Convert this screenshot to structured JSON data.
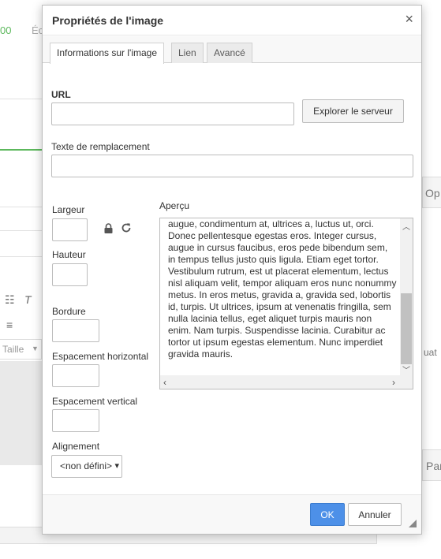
{
  "background": {
    "left_frag1": "00",
    "left_frag2": "Éc",
    "right_frag1": "Op",
    "right_frag2": "uat",
    "right_frag3": "Par",
    "size_dropdown": "Taille"
  },
  "dialog": {
    "title": "Propriétés de l'image",
    "close_glyph": "×",
    "tabs": [
      {
        "label": "Informations sur l'image"
      },
      {
        "label": "Lien"
      },
      {
        "label": "Avancé"
      }
    ],
    "url_label": "URL",
    "url_value": "",
    "browse_button": "Explorer le serveur",
    "alt_label": "Texte de remplacement",
    "alt_value": "",
    "width_label": "Largeur",
    "height_label": "Hauteur",
    "border_label": "Bordure",
    "hspace_label": "Espacement horizontal",
    "vspace_label": "Espacement vertical",
    "align_label": "Alignement",
    "align_value": "<non défini>",
    "preview_label": "Aperçu",
    "preview_text": "augue, condimentum at, ultrices a, luctus ut, orci. Donec pellentesque egestas eros. Integer cursus, augue in cursus faucibus, eros pede bibendum sem, in tempus tellus justo quis ligula. Etiam eget tortor. Vestibulum rutrum, est ut placerat elementum, lectus nisl aliquam velit, tempor aliquam eros nunc nonummy metus. In eros metus, gravida a, gravida sed, lobortis id, turpis. Ut ultrices, ipsum at venenatis fringilla, sem nulla lacinia tellus, eget aliquet turpis mauris non enim. Nam turpis. Suspendisse lacinia. Curabitur ac tortor ut ipsum egestas elementum. Nunc imperdiet gravida mauris.",
    "ok_button": "OK",
    "cancel_button": "Annuler"
  },
  "colors": {
    "ok_accent": "#4d90e8",
    "green_accent": "#5cb85c"
  },
  "icons": [
    "close-icon",
    "lock-icon",
    "reset-size-icon",
    "resize-handle-icon"
  ]
}
